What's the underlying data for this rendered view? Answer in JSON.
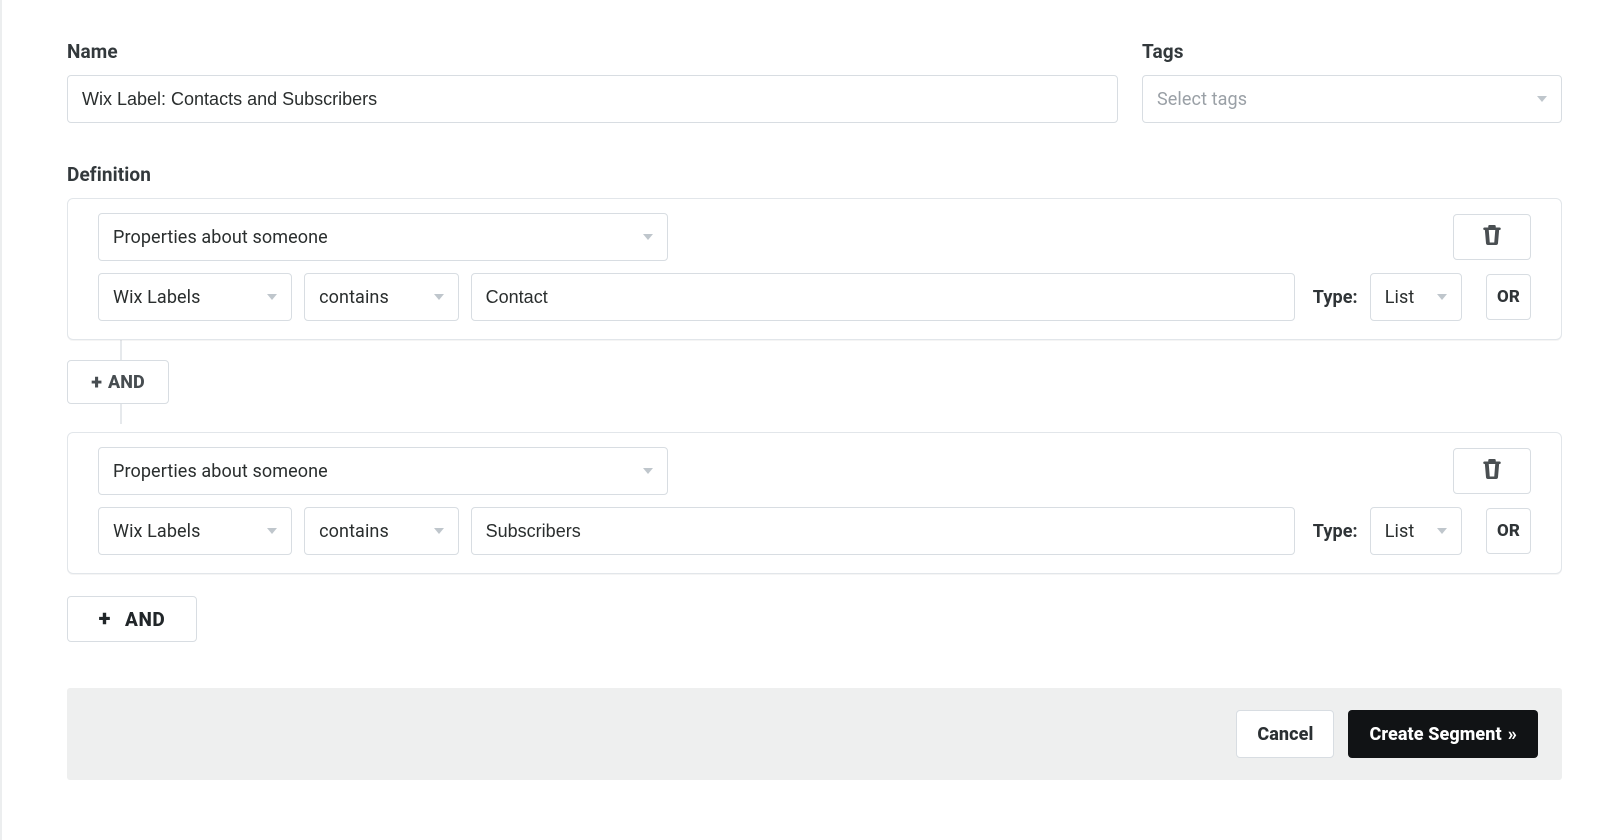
{
  "labels": {
    "name": "Name",
    "tags": "Tags",
    "definition": "Definition",
    "type": "Type:",
    "and_small": "AND",
    "and_large": "AND",
    "plus": "+",
    "or": "OR"
  },
  "name_field": {
    "value": "Wix Label: Contacts and Subscribers"
  },
  "tags_select": {
    "placeholder": "Select tags"
  },
  "conditions": [
    {
      "dimension": "Properties about someone",
      "property": "Wix Labels",
      "operator": "contains",
      "value": "Contact",
      "type": "List"
    },
    {
      "dimension": "Properties about someone",
      "property": "Wix Labels",
      "operator": "contains",
      "value": "Subscribers",
      "type": "List"
    }
  ],
  "footer": {
    "cancel": "Cancel",
    "submit": "Create Segment",
    "submit_arrow": "»"
  }
}
